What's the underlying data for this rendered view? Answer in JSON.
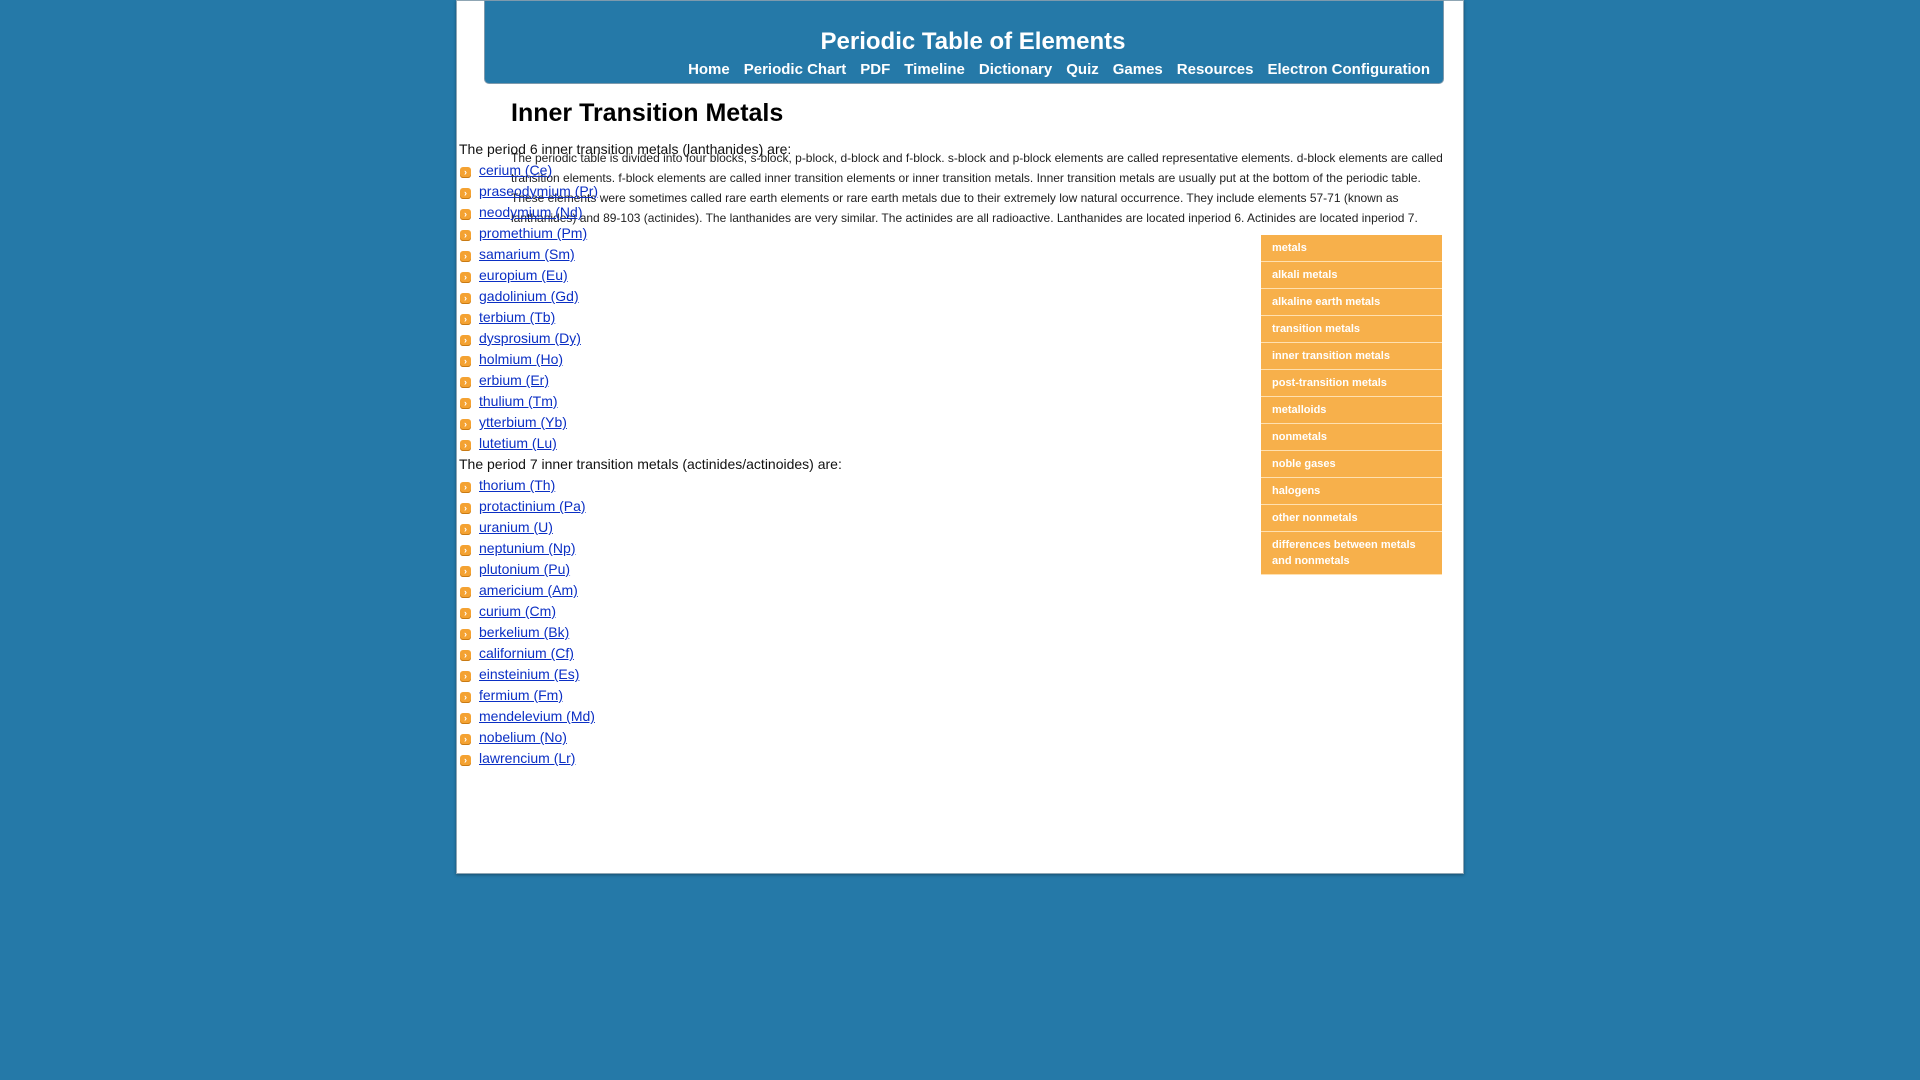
{
  "header": {
    "title": "Periodic Table of Elements",
    "nav": [
      "Home",
      "Periodic Chart",
      "PDF",
      "Timeline",
      "Dictionary",
      "Quiz",
      "Games",
      "Resources",
      "Electron Configuration"
    ]
  },
  "main": {
    "title": "Inner Transition Metals",
    "intro": "The periodic table is divided into four blocks, s-block, p-block, d-block and f-block. s-block and p-block elements are called representative elements. d-block elements are called transition elements. f-block elements are called inner transition elements or inner transition metals. Inner transition metals are usually put at the bottom of the periodic table. These elements were sometimes called rare earth elements or rare earth metals due to their extremely low natural occurrence. They include elements 57-71 (known as lanthanides) and 89-103 (actinides). The lanthanides are very similar. The actinides are all radioactive. Lanthanides are located inperiod 6. Actinides are located inperiod 7.",
    "lanthanides_heading": "The period 6 inner transition metals (lanthanides) are:",
    "lanthanides": [
      "cerium (Ce)",
      "praseodymium (Pr)",
      "neodymium (Nd)",
      "promethium (Pm)",
      "samarium (Sm)",
      "europium (Eu)",
      "gadolinium (Gd)",
      "terbium (Tb)",
      "dysprosium (Dy)",
      "holmium (Ho)",
      "erbium (Er)",
      "thulium (Tm)",
      "ytterbium (Yb)",
      "lutetium (Lu)"
    ],
    "actinides_heading": "The period 7 inner transition metals (actinides/actinoides) are:",
    "actinides": [
      "thorium (Th)",
      "protactinium (Pa)",
      "uranium (U)",
      "neptunium (Np)",
      "plutonium (Pu)",
      "americium (Am)",
      "curium (Cm)",
      "berkelium (Bk)",
      "californium (Cf)",
      "einsteinium (Es)",
      "fermium (Fm)",
      "mendelevium (Md)",
      "nobelium (No)",
      "lawrencium (Lr)"
    ]
  },
  "sidebar": {
    "items": [
      "metals",
      "alkali metals",
      "alkaline earth metals",
      "transition metals",
      "inner transition metals",
      "post-transition metals",
      "metalloids",
      "nonmetals",
      "noble gases",
      "halogens",
      "other nonmetals",
      "differences between metals and nonmetals"
    ]
  },
  "icons": {
    "bullet": "chevron-right-icon"
  },
  "colors": {
    "background": "#2579a8",
    "link": "#0b2fc4",
    "sidebar": "#f7b04b",
    "bullet": "#f4a232"
  }
}
